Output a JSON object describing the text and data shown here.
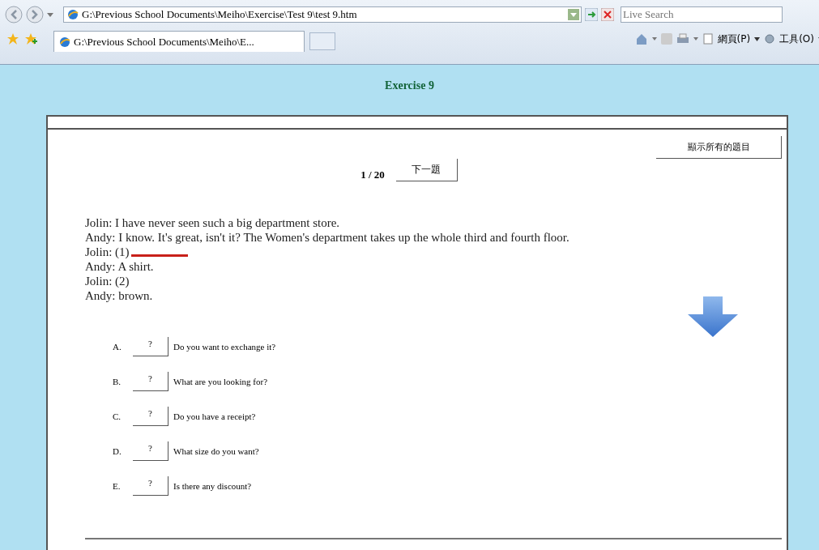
{
  "browser": {
    "address": "G:\\Previous School Documents\\Meiho\\Exercise\\Test 9\\test 9.htm",
    "search_placeholder": "Live Search",
    "tab_title": "G:\\Previous School Documents\\Meiho\\E...",
    "menus": [
      "網頁(P)",
      "工具(O)"
    ]
  },
  "page": {
    "title": "Exercise 9",
    "show_all_button": "顯示所有的題目",
    "counter": "1 / 20",
    "next_button": "下一題",
    "dialog": [
      {
        "text": "Jolin: I have never seen such a big department store.",
        "marked": false
      },
      {
        "text": "Andy: I know. It's great, isn't it?  The Women's department takes up the whole third and fourth floor.",
        "marked": false
      },
      {
        "text": "Jolin: (1)",
        "marked": true
      },
      {
        "text": "Andy: A shirt.",
        "marked": false
      },
      {
        "text": "Jolin: (2)",
        "marked": false
      },
      {
        "text": "Andy: brown.",
        "marked": false
      }
    ],
    "options": [
      {
        "letter": "A.",
        "answer": "?",
        "text": "Do you want to exchange it?"
      },
      {
        "letter": "B.",
        "answer": "?",
        "text": "What are you looking for?"
      },
      {
        "letter": "C.",
        "answer": "?",
        "text": "Do you have a receipt?"
      },
      {
        "letter": "D.",
        "answer": "?",
        "text": "What size do you want?"
      },
      {
        "letter": "E.",
        "answer": "?",
        "text": "Is there any discount?"
      }
    ]
  }
}
